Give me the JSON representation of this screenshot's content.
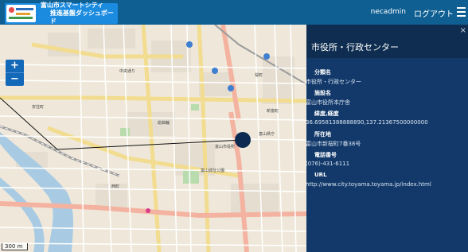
{
  "header": {
    "logo_line1": "富山市スマートシティ",
    "logo_line2": "推進基盤ダッシュボード",
    "user": "necadmin",
    "logout": "ログアウト"
  },
  "map": {
    "zoom_in": "+",
    "zoom_out": "−",
    "scale": "300 m",
    "labels": [
      "富山城址公園",
      "富山市役所",
      "富山県庁",
      "西町",
      "総曲輪",
      "中央通り",
      "桜町",
      "新富町",
      "安住町"
    ]
  },
  "panel": {
    "close": "×",
    "title": "市役所・行政センター",
    "fields": [
      {
        "label": "分類名",
        "value": "市役所・行政センター"
      },
      {
        "label": "施設名",
        "value": "富山市役所本庁舎"
      },
      {
        "label": "緯度,経度",
        "value": "36.69581388888890,137.21367500000000"
      },
      {
        "label": "所在地",
        "value": "富山市新桜町7番38号"
      },
      {
        "label": "電話番号",
        "value": "(076)-431-6111"
      },
      {
        "label": "URL",
        "value": "http://www.city.toyama.toyama.jp/index.html"
      }
    ]
  },
  "colors": {
    "header": "#0f5f93",
    "panel": "#0e2d50",
    "marker": "#0d2a52"
  }
}
